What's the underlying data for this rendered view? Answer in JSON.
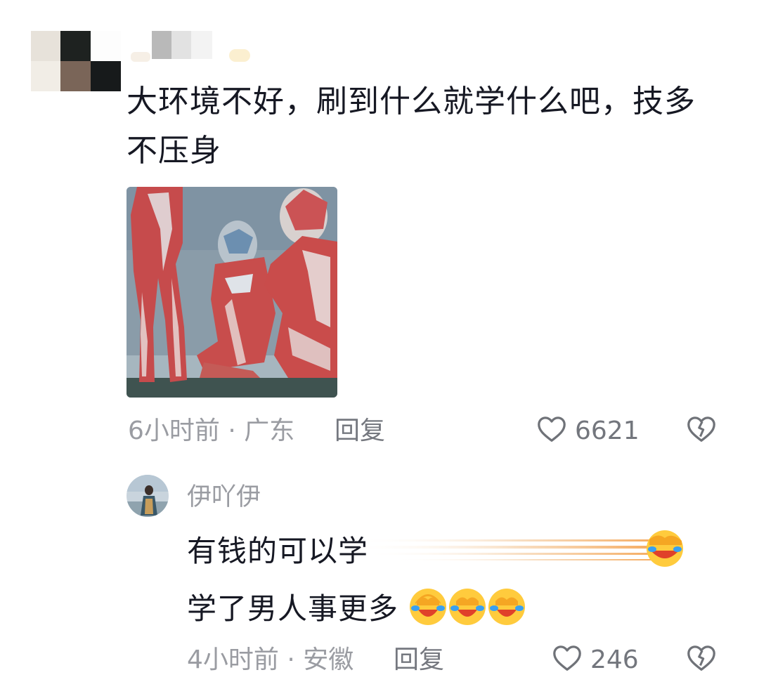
{
  "comment": {
    "username": "",
    "text": "大环境不好，刷到什么就学什么吧，技多不压身",
    "time": "6小时前",
    "location": "广东",
    "separator": " · ",
    "reply_label": "回复",
    "like_count": "6621"
  },
  "reply": {
    "username": "伊吖伊",
    "line1": "有钱的可以学",
    "line2": "学了男人事更多",
    "time": "4小时前",
    "location": "安徽",
    "separator": " · ",
    "reply_label": "回复",
    "like_count": "246",
    "emoji_line2": [
      "face-with-tears-emoji",
      "face-with-tears-emoji",
      "face-with-tears-emoji"
    ]
  },
  "icons": {
    "like": "heart-outline-icon",
    "dislike": "broken-heart-icon"
  },
  "colors": {
    "text_primary": "#161823",
    "text_secondary": "#9a9ca2",
    "background": "#ffffff"
  }
}
